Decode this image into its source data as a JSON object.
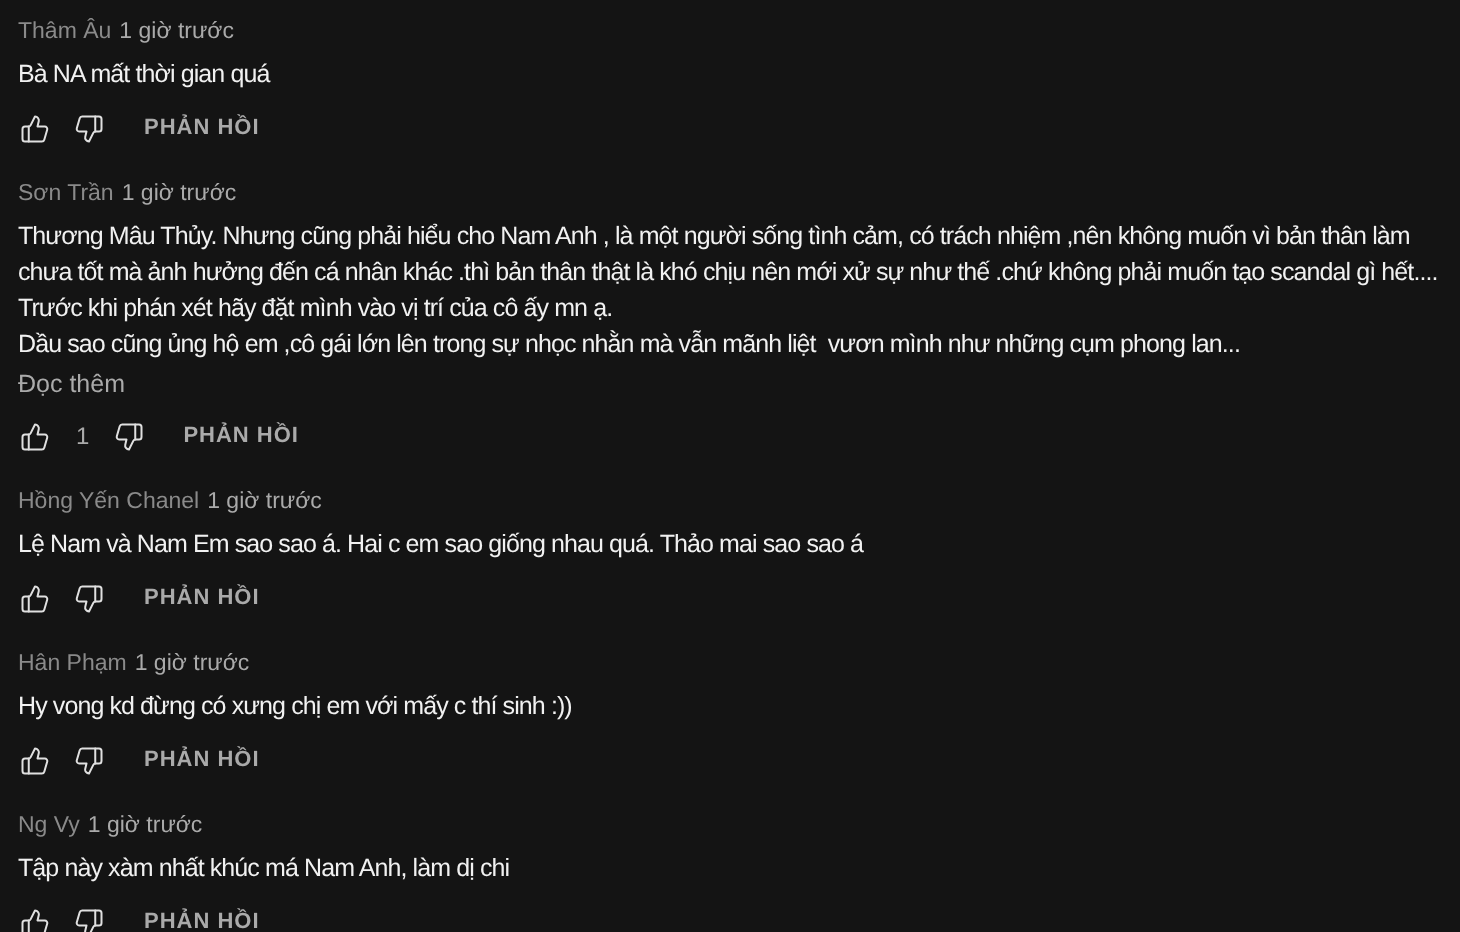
{
  "comments": [
    {
      "author": "Thâm Âu",
      "time": "1 giờ trước",
      "lines": [
        "Bà NA mất thời gian quá"
      ],
      "reply": "PHẢN HỒI"
    },
    {
      "author": "Sơn Trần",
      "time": "1 giờ trước",
      "lines": [
        "Thương Mâu Thủy. Nhưng cũng phải hiểu cho Nam Anh , là một người sống tình cảm, có trách nhiệm ,nên không muốn vì bản thân làm",
        "chưa tốt mà ảnh hưởng đến cá nhân khác .thì bản thân thật là khó chịu nên mới xử sự như thế .chứ không phải muốn tạo scandal gì hết....",
        "Trước khi phán xét hãy đặt mình vào vị trí của cô ấy mn ạ.",
        "Dầu sao cũng ủng hộ em ,cô gái lớn lên trong sự nhọc nhằn mà vẫn mãnh liệt  vươn mình như những cụm phong lan..."
      ],
      "read_more": "Đọc thêm",
      "likes": "1",
      "reply": "PHẢN HỒI"
    },
    {
      "author": "Hồng Yến Chanel",
      "time": "1 giờ trước",
      "lines": [
        "Lệ Nam và Nam Em sao sao á. Hai c em sao giống nhau quá. Thảo mai sao sao á"
      ],
      "reply": "PHẢN HỒI"
    },
    {
      "author": "Hân Phạm",
      "time": "1 giờ trước",
      "lines": [
        "Hy vong kd đừng có xưng chị em với mấy c thí sinh :))"
      ],
      "reply": "PHẢN HỒI"
    },
    {
      "author": "Ng Vy",
      "time": "1 giờ trước",
      "lines": [
        "Tập này xàm nhất khúc má Nam Anh, làm dị chi"
      ],
      "reply": "PHẢN HỒI"
    }
  ]
}
